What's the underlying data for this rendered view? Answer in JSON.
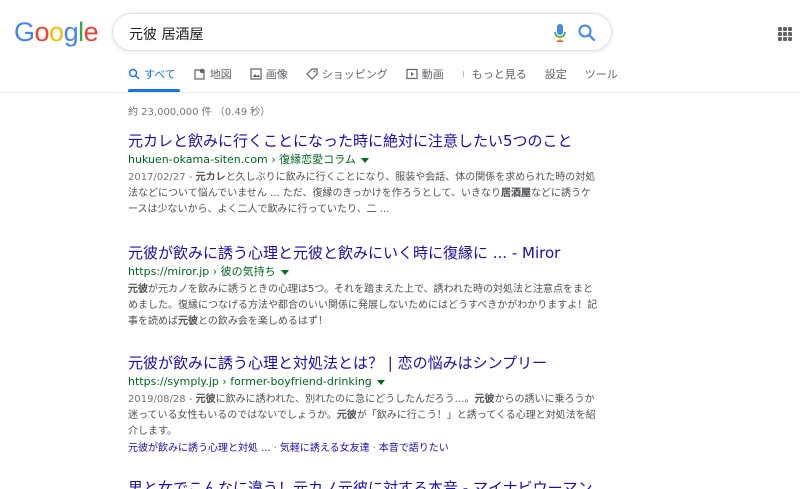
{
  "logo": {
    "letters": [
      "G",
      "o",
      "o",
      "g",
      "l",
      "e"
    ],
    "colors": [
      "#4285f4",
      "#ea4335",
      "#fbbc05",
      "#4285f4",
      "#34a853",
      "#ea4335"
    ]
  },
  "search": {
    "query": "元彼 居酒屋"
  },
  "tabs": [
    {
      "label": "すべて",
      "icon": "search-icon",
      "active": true
    },
    {
      "label": "地図",
      "icon": "map-icon"
    },
    {
      "label": "画像",
      "icon": "image-icon"
    },
    {
      "label": "ショッピング",
      "icon": "tag-icon"
    },
    {
      "label": "動画",
      "icon": "video-icon"
    },
    {
      "label": "もっと見る",
      "icon": "more-vert-icon"
    },
    {
      "label": "設定"
    },
    {
      "label": "ツール"
    }
  ],
  "stats": "約 23,000,000 件 （0.49 秒）",
  "results": [
    {
      "title": "元カレと飲みに行くことになった時に絶対に注意したい5つのこと",
      "url": "hukuen-okama-siten.com › 復縁恋愛コラム",
      "date": "2017/02/27 - ",
      "snippet": [
        {
          "t": "元カレ",
          "b": true
        },
        {
          "t": "と久しぶりに飲みに行くことになり、服装や会話、体の関係を求められた時の対処法などについて悩んでいません ... ただ、復縁のきっかけを作ろうとして、いきなり"
        },
        {
          "t": "居酒屋",
          "b": true
        },
        {
          "t": "などに誘うケースは少ないから、よく二人で飲みに行っていたり、二 ..."
        }
      ]
    },
    {
      "title": "元彼が飲みに誘う心理と元彼と飲みにいく時に復縁に ... - Miror",
      "url": "https://miror.jp › 彼の気持ち",
      "date": "",
      "snippet": [
        {
          "t": "元彼",
          "b": true
        },
        {
          "t": "が元カノを飲みに誘うときの心理は5つ。それを踏まえた上で、誘われた時の対処法と注意点をまとめました。復縁につなげる方法や都合のいい関係に発展しないためにはどうすべきかがわかりますよ！記事を読めば"
        },
        {
          "t": "元彼",
          "b": true
        },
        {
          "t": "との飲み会を楽しめるはず！"
        }
      ]
    },
    {
      "title": "元彼が飲みに誘う心理と対処法とは？ | 恋の悩みはシンプリー",
      "url": "https://symply.jp › former-boyfriend-drinking",
      "date": "2019/08/28 - ",
      "snippet": [
        {
          "t": "元彼",
          "b": true
        },
        {
          "t": "に飲みに誘われた、別れたのに急にどうしたんだろう…。"
        },
        {
          "t": "元彼",
          "b": true
        },
        {
          "t": "からの誘いに乗ろうか迷っている女性もいるのではないでしょうか。"
        },
        {
          "t": "元彼",
          "b": true
        },
        {
          "t": "が「飲みに行こう！」と誘ってくる心理と対処法を紹介します。"
        }
      ],
      "sitelinks": [
        "元彼が飲みに誘う心理と対処 ...",
        "気軽に誘える女友達",
        "本音で語りたい"
      ]
    },
    {
      "title": "男と女でこんなに違う！元カノ元彼に対する本音 - マイナビウーマン",
      "url": "",
      "date": "",
      "snippet": []
    }
  ]
}
